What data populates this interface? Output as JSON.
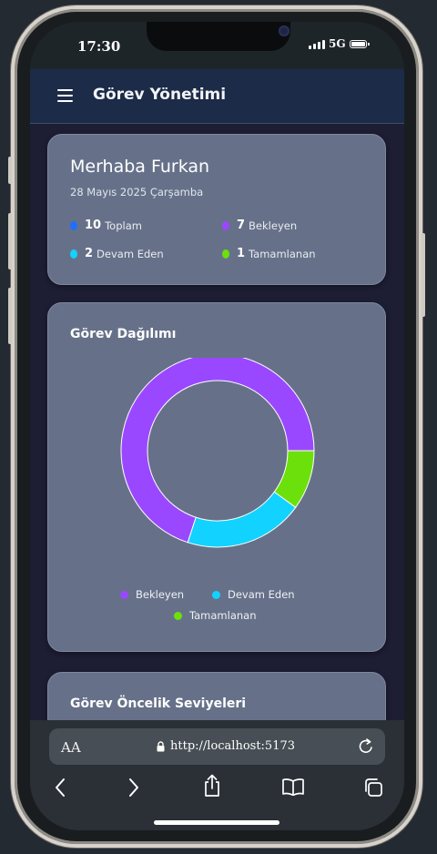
{
  "status_bar": {
    "time": "17:30",
    "network": "5G"
  },
  "app": {
    "title": "Görev Yönetimi"
  },
  "summary": {
    "greeting": "Merhaba Furkan",
    "date": "28 Mayıs 2025 Çarşamba",
    "stats": [
      {
        "count": "10",
        "label": "Toplam",
        "color": "#1f6fff"
      },
      {
        "count": "7",
        "label": "Bekleyen",
        "color": "#9a48ff"
      },
      {
        "count": "2",
        "label": "Devam Eden",
        "color": "#12d2ff"
      },
      {
        "count": "1",
        "label": "Tamamlanan",
        "color": "#6ce00b"
      }
    ]
  },
  "distribution": {
    "title": "Görev Dağılımı",
    "legend": [
      {
        "label": "Bekleyen",
        "color": "#9a48ff"
      },
      {
        "label": "Devam Eden",
        "color": "#12d2ff"
      },
      {
        "label": "Tamamlanan",
        "color": "#6ce00b"
      }
    ]
  },
  "chart_data": {
    "type": "pie",
    "variant": "doughnut",
    "categories": [
      "Bekleyen",
      "Devam Eden",
      "Tamamlanan"
    ],
    "values": [
      7,
      2,
      1
    ],
    "colors": [
      "#9a48ff",
      "#12d2ff",
      "#6ce00b"
    ],
    "legend_position": "bottom"
  },
  "priority": {
    "title": "Görev Öncelik Seviyeleri"
  },
  "browser": {
    "text_size_label": "AA",
    "url": "http://localhost:5173"
  }
}
